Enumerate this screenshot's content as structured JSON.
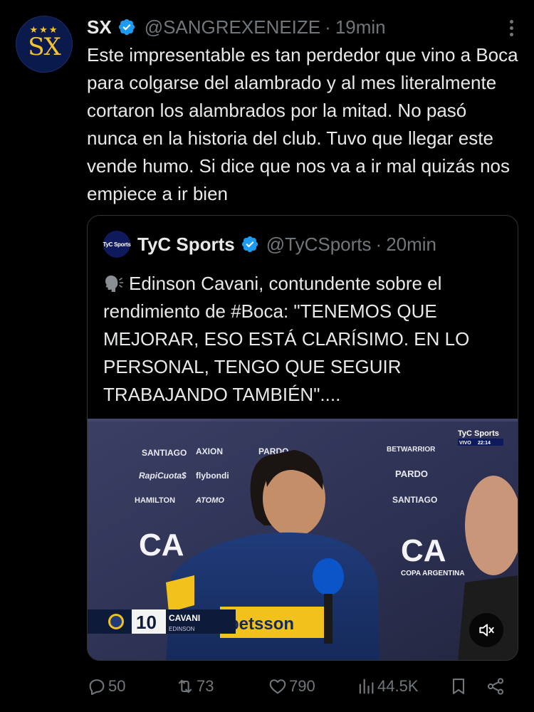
{
  "post": {
    "avatar": {
      "stars": "★★★",
      "monogram": "SX"
    },
    "author_name": "SX",
    "handle": "@SANGREXENEIZE",
    "separator": "·",
    "time": "19min",
    "text": "Este impresentable es tan perdedor que vino a Boca para colgarse del alambrado y al mes literalmente cortaron los alambrados por la mitad. No pasó nunca en la historia del club. Tuvo que llegar este vende humo. Si dice que nos va a ir mal quizás nos empiece a ir bien"
  },
  "quote": {
    "avatar_text": "TyC Sports",
    "author_name": "TyC Sports",
    "handle": "@TyCSports",
    "separator": "·",
    "time": "20min",
    "text": "Edinson Cavani, contundente sobre el rendimiento de #Boca: \"TENEMOS QUE MEJORAR, ESO ESTÁ CLARÍSIMO. EN LO PERSONAL, TENGO QUE SEGUIR TRABAJANDO TAMBIÉN\"....",
    "media": {
      "broadcaster": "TyC Sports",
      "vivo_label": "VIVO",
      "clock": "22:14",
      "backdrop_sponsors": [
        "SANTIAGO",
        "AXION",
        "PARDO",
        "BETWARRIOR",
        "HAMILTON",
        "RapiCuota$",
        "flybondi",
        "ATOMO",
        "SANTIAGO",
        "PARDO"
      ],
      "cup_logo_text": "CA",
      "cup_name": "COPA ARGENTINA",
      "shirt_sponsor": "betsson",
      "lower_third": {
        "number": "10",
        "surname": "CAVANI",
        "first_name": "EDINSON"
      }
    }
  },
  "actions": {
    "replies": "50",
    "reposts": "73",
    "likes": "790",
    "views": "44.5K"
  },
  "colors": {
    "background": "#000000",
    "text": "#e7e9ea",
    "muted": "#71767b",
    "verified": "#1d9bf0",
    "border": "#2f3336"
  },
  "icons": [
    "verified-badge-icon",
    "more-options-icon",
    "speaking-head-icon",
    "mute-icon",
    "reply-icon",
    "repost-icon",
    "like-icon",
    "views-icon",
    "bookmark-icon",
    "share-icon"
  ]
}
